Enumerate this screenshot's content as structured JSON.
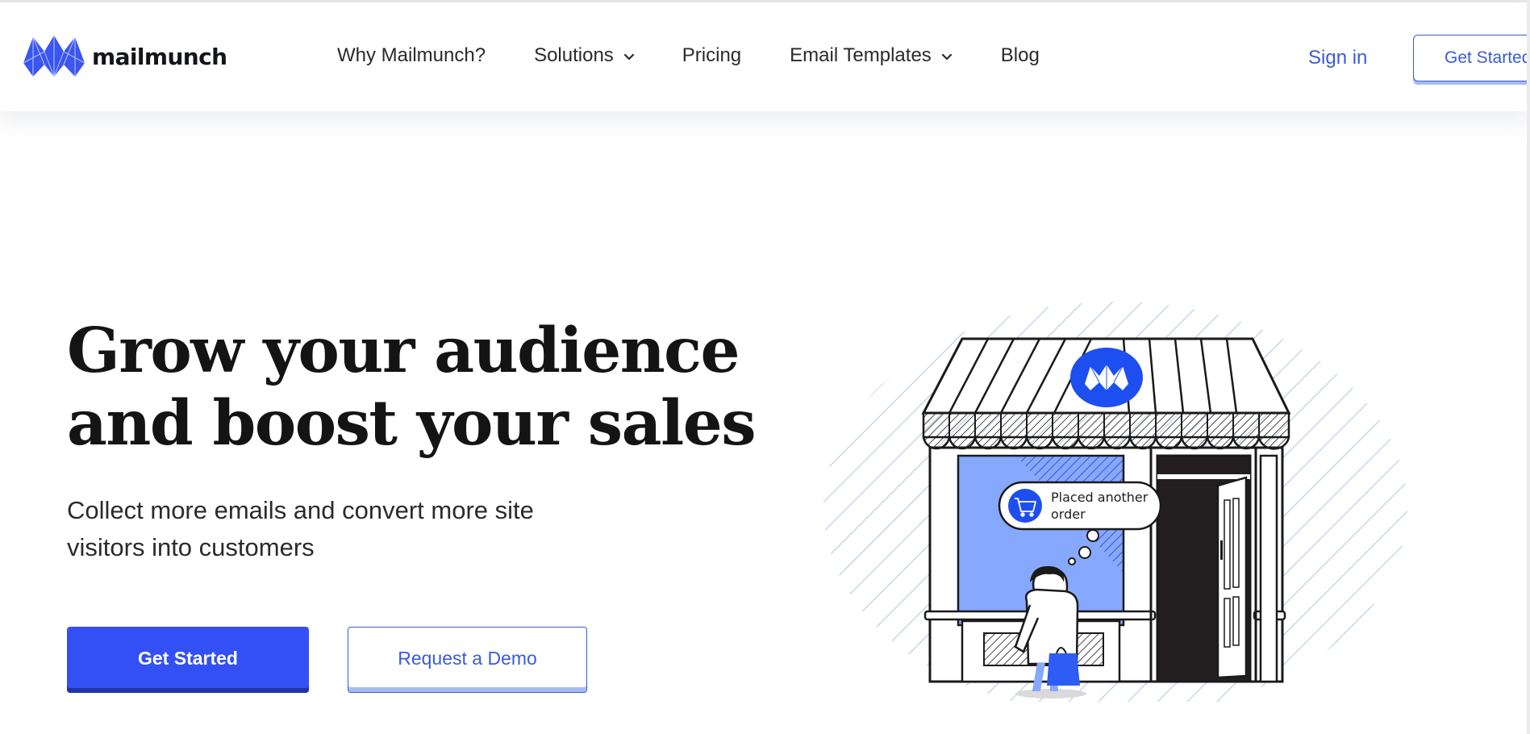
{
  "brand": {
    "name": "mailmunch",
    "accent": "#3350f5",
    "link": "#3a5bd9"
  },
  "nav": {
    "items": [
      {
        "label": "Why Mailmunch?",
        "dropdown": false
      },
      {
        "label": "Solutions",
        "dropdown": true
      },
      {
        "label": "Pricing",
        "dropdown": false
      },
      {
        "label": "Email Templates",
        "dropdown": true
      },
      {
        "label": "Blog",
        "dropdown": false
      }
    ],
    "sign_in": "Sign in",
    "get_started": "Get Started"
  },
  "hero": {
    "title_line1": "Grow your audience",
    "title_line2": "and boost your sales",
    "subtitle_line1": "Collect more emails and convert more site",
    "subtitle_line2": "visitors into customers",
    "primary_cta": "Get Started",
    "secondary_cta": "Request a Demo"
  },
  "illustration": {
    "bubble_line1": "Placed another",
    "bubble_line2": "order",
    "icons": [
      "storefront",
      "cart-icon",
      "shopping-bag-icon",
      "mailmunch-logo-badge"
    ]
  }
}
